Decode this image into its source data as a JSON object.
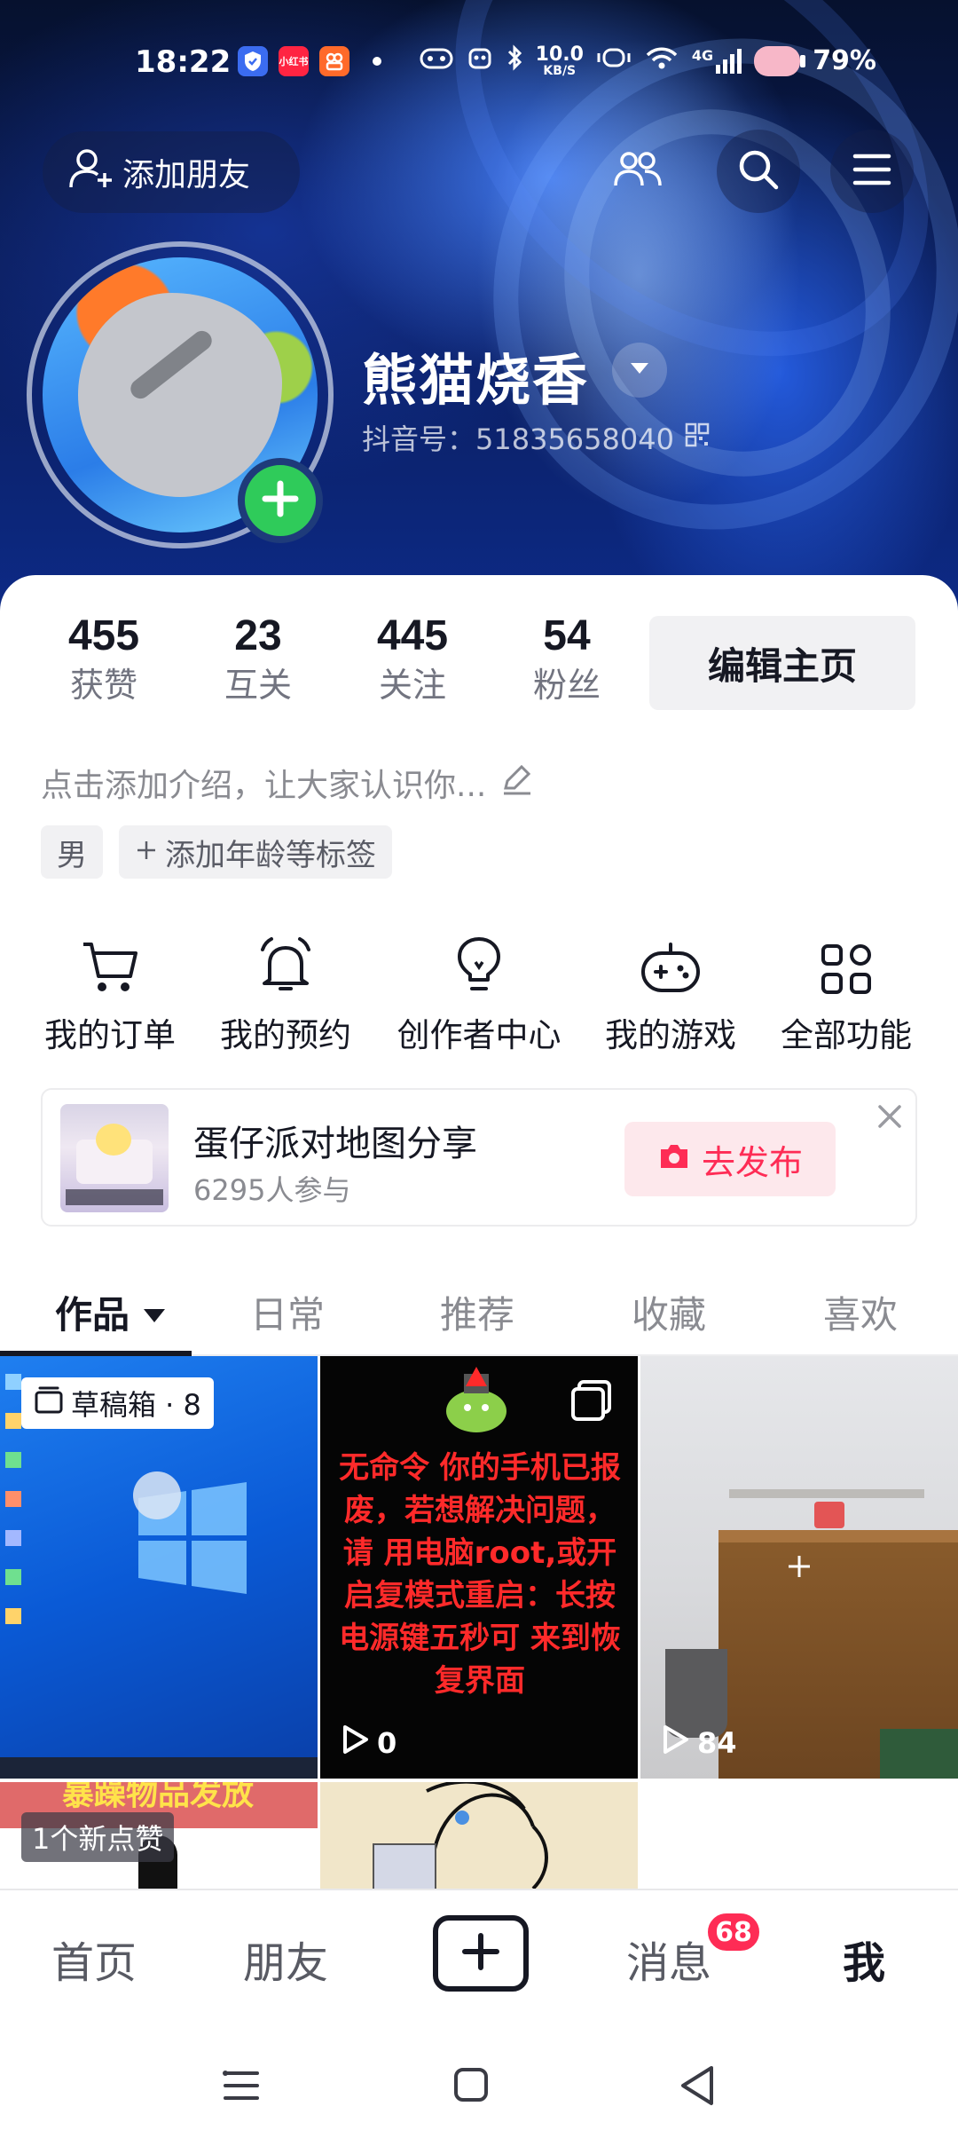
{
  "status_bar": {
    "time": "18:22",
    "network_speed_value": "10.0",
    "network_speed_unit": "KB/S",
    "signal": "4G",
    "battery": "79%",
    "icons": [
      "shield-icon",
      "xiaohongshu-icon",
      "app-icon",
      "dot-icon",
      "gamepad-icon",
      "robot-icon",
      "bluetooth-icon",
      "speed-icon",
      "vibrate-icon",
      "wifi-icon",
      "signal-icon",
      "battery-icon"
    ],
    "app_badge_text": "小红书"
  },
  "header": {
    "add_friend_label": "添加朋友",
    "username": "熊猫烧香",
    "douyin_id": "抖音号：51835658040"
  },
  "stats": [
    {
      "value": "455",
      "label": "获赞"
    },
    {
      "value": "23",
      "label": "互关"
    },
    {
      "value": "445",
      "label": "关注"
    },
    {
      "value": "54",
      "label": "粉丝"
    }
  ],
  "edit_profile_label": "编辑主页",
  "bio_placeholder": "点击添加介绍，让大家认识你...",
  "tags": {
    "gender": "男",
    "add_tag": "添加年龄等标签"
  },
  "functions": [
    {
      "label": "我的订单",
      "icon": "cart-icon"
    },
    {
      "label": "我的预约",
      "icon": "bell-icon"
    },
    {
      "label": "创作者中心",
      "icon": "lightbulb-icon"
    },
    {
      "label": "我的游戏",
      "icon": "gamepad-icon"
    },
    {
      "label": "全部功能",
      "icon": "grid-icon"
    }
  ],
  "promo": {
    "title": "蛋仔派对地图分享",
    "participants": "6295人参与",
    "button_label": "去发布"
  },
  "tabs": [
    {
      "label": "作品",
      "active": true
    },
    {
      "label": "日常",
      "active": false
    },
    {
      "label": "推荐",
      "active": false
    },
    {
      "label": "收藏",
      "active": false
    },
    {
      "label": "喜欢",
      "active": false
    }
  ],
  "videos": {
    "draft_label": "草稿箱 · 8",
    "video2_text": "无命令 你的手机已报废，若想解决问题，请 用电脑root,或开启复模式重启：长按电源键五秒可 来到恢复界面",
    "video2_views": "0",
    "video3_views": "84",
    "new_like_label": "1个新点赞",
    "thumb_partial_text": "暴躁物品发放"
  },
  "bottom_nav": {
    "home": "首页",
    "friends": "朋友",
    "messages": "消息",
    "messages_badge": "68",
    "me": "我"
  },
  "colors": {
    "accent": "#fe2c55",
    "plus_badge": "#2fcb5a",
    "header_bg": "#0d2a86"
  }
}
